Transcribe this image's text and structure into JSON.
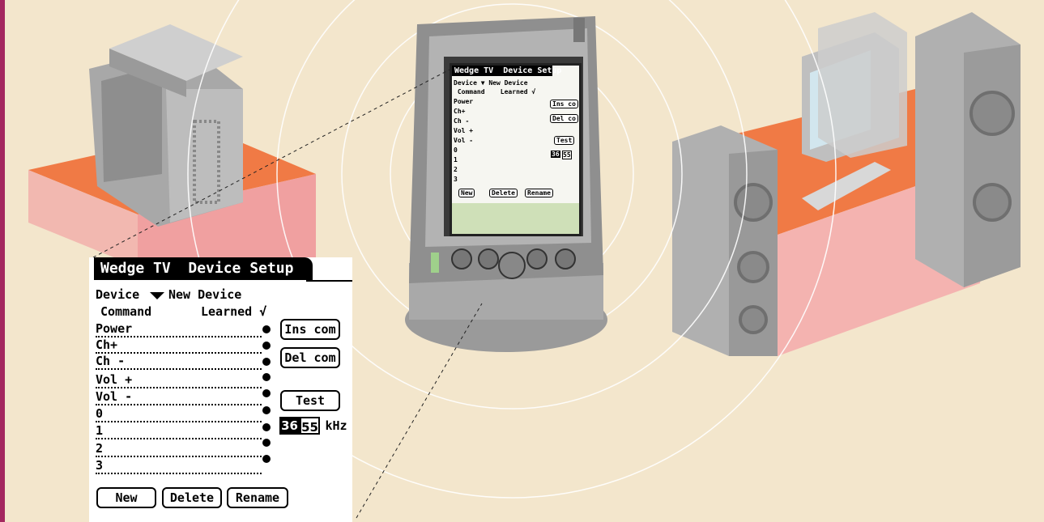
{
  "dialog": {
    "title": "Wedge TV  Device Setup",
    "device_label": "Device",
    "device_value": "New Device",
    "header_command": "Command",
    "header_learned": "Learned √",
    "commands": [
      "Power",
      "Ch+",
      "Ch -",
      "Vol +",
      "Vol -",
      "0",
      "1",
      "2",
      "3"
    ],
    "buttons": {
      "ins_com": "Ins com",
      "del_com": "Del com",
      "test": "Test",
      "new": "New",
      "delete": "Delete",
      "rename": "Rename"
    },
    "frequency": {
      "value_1": "36",
      "value_2": "55",
      "unit": "kHz"
    }
  },
  "handheld": {
    "title": "Wedge TV  Device Setup",
    "device_row": "Device ▼ New Device",
    "header_row": " Command    Learned √",
    "commands": [
      "Power",
      "Ch+",
      "Ch -",
      "Vol +",
      "Vol -",
      "0",
      "1",
      "2",
      "3"
    ],
    "buttons": {
      "ins_com": "Ins co",
      "del_com": "Del co",
      "test": "Test",
      "new": "New",
      "delete": "Delete",
      "rename": "Rename"
    },
    "frequency": {
      "value_1": "36",
      "value_2": "55"
    }
  },
  "colors": {
    "background": "#f3e6cc",
    "page_border": "#a4275f",
    "desk_top": "#f07a45",
    "desk_side": "#f4b3b0",
    "device_gray": "#9c9c9c",
    "screen_green": "#cfe0b8"
  },
  "icons": [
    "dropdown-triangle-icon",
    "tv-set-icon",
    "handheld-pda-icon",
    "desktop-computer-icon",
    "speaker-icon"
  ]
}
